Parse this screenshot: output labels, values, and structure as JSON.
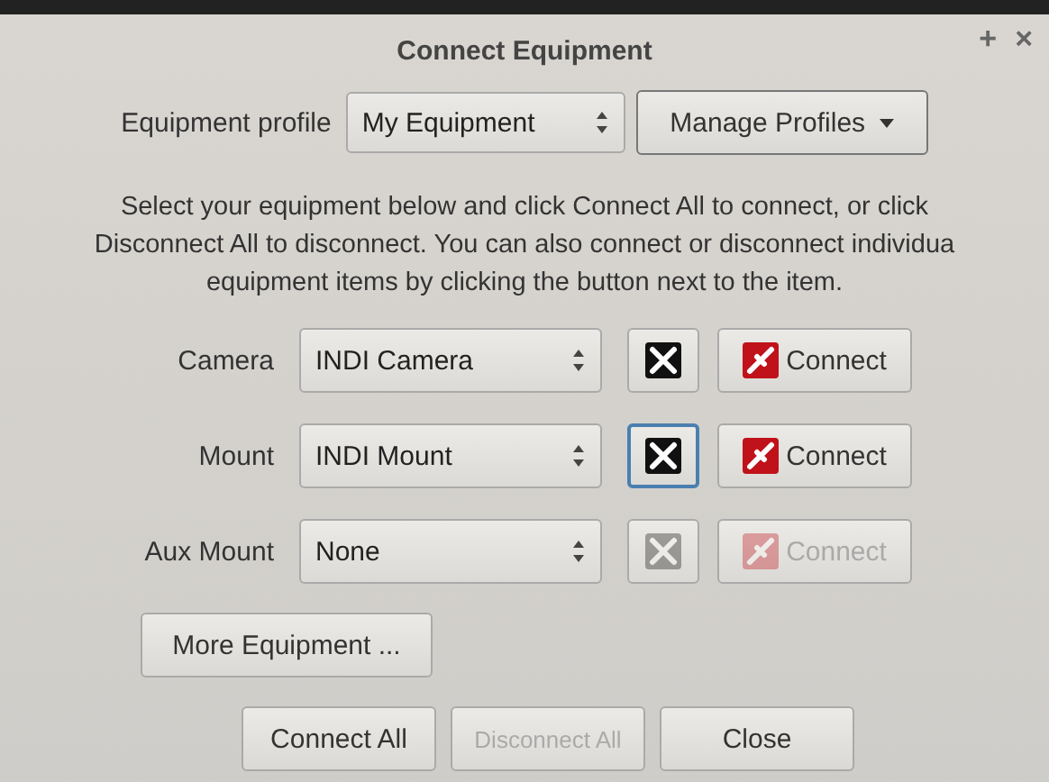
{
  "window": {
    "title": "Connect Equipment",
    "buttons": [
      "+",
      "×"
    ]
  },
  "profile": {
    "label": "Equipment profile",
    "value": "My Equipment",
    "manage": "Manage Profiles"
  },
  "instructions": [
    "Select your equipment below and click Connect All to connect, or click",
    "Disconnect All to disconnect. You can also connect or disconnect individua",
    "equipment items by clicking the button next to the item."
  ],
  "equipment": [
    {
      "label": "Camera",
      "value": "INDI Camera",
      "disabled": false,
      "focused": false,
      "connect": "Connect"
    },
    {
      "label": "Mount",
      "value": "INDI Mount",
      "disabled": false,
      "focused": true,
      "connect": "Connect"
    },
    {
      "label": "Aux Mount",
      "value": "None",
      "disabled": true,
      "focused": false,
      "connect": "Connect"
    }
  ],
  "more": "More Equipment ...",
  "buttons": [
    {
      "label": "Connect All",
      "disabled": false
    },
    {
      "label": "Disconnect All",
      "disabled": true
    },
    {
      "label": "Close",
      "disabled": false
    }
  ]
}
